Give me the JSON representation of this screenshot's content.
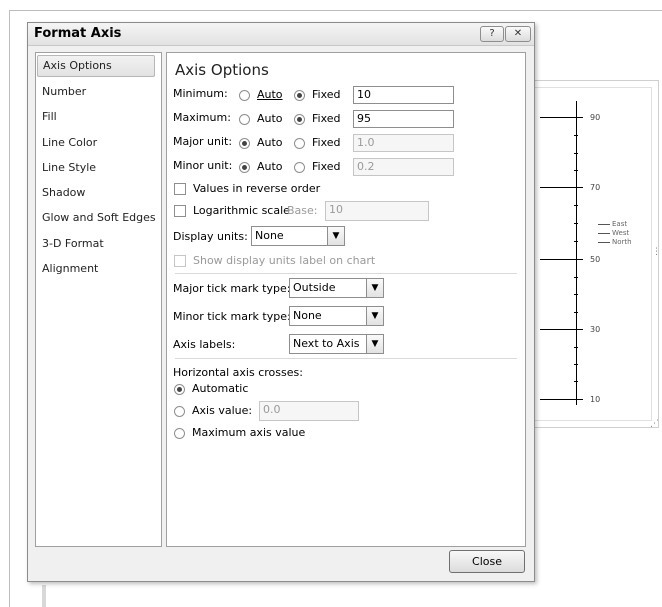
{
  "dialog": {
    "title": "Format Axis",
    "help_button": "?",
    "close_x": "✕",
    "close_button": "Close"
  },
  "nav": {
    "items": [
      {
        "label": "Axis Options"
      },
      {
        "label": "Number"
      },
      {
        "label": "Fill"
      },
      {
        "label": "Line Color"
      },
      {
        "label": "Line Style"
      },
      {
        "label": "Shadow"
      },
      {
        "label": "Glow and Soft Edges"
      },
      {
        "label": "3-D Format"
      },
      {
        "label": "Alignment"
      }
    ],
    "selected": "Axis Options"
  },
  "axis_options": {
    "heading": "Axis Options",
    "minimum": {
      "label": "Minimum:",
      "mode": "Fixed",
      "value": "10"
    },
    "maximum": {
      "label": "Maximum:",
      "mode": "Fixed",
      "value": "95"
    },
    "major_unit": {
      "label": "Major unit:",
      "mode": "Auto",
      "value": "1.0"
    },
    "minor_unit": {
      "label": "Minor unit:",
      "mode": "Auto",
      "value": "0.2"
    },
    "auto_label": "Auto",
    "fixed_label": "Fixed",
    "values_reverse": {
      "label": "Values in reverse order",
      "checked": false
    },
    "log_scale": {
      "label": "Logarithmic scale",
      "checked": false,
      "base_label": "Base:",
      "base_value": "10"
    },
    "display_units": {
      "label": "Display units:",
      "value": "None"
    },
    "show_units_label": {
      "label": "Show display units label on chart",
      "checked": false
    },
    "major_tick": {
      "label": "Major tick mark type:",
      "value": "Outside"
    },
    "minor_tick": {
      "label": "Minor tick mark type:",
      "value": "None"
    },
    "axis_labels": {
      "label": "Axis labels:",
      "value": "Next to Axis"
    },
    "horizontal_crosses": {
      "label": "Horizontal axis crosses:",
      "automatic": "Automatic",
      "axis_value": "Axis value:",
      "axis_value_input": "0.0",
      "max_value": "Maximum axis value",
      "selected": "Automatic"
    }
  },
  "background_chart": {
    "tick_labels": [
      "90",
      "70",
      "50",
      "30",
      "10"
    ],
    "legend": [
      "East",
      "West",
      "North"
    ]
  }
}
